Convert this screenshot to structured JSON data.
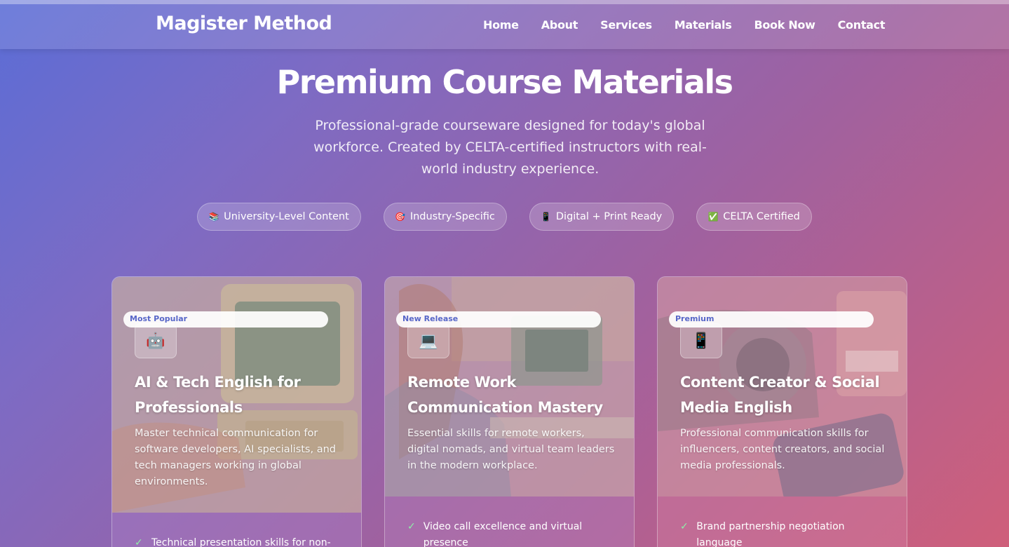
{
  "header": {
    "brand": "Magister Method",
    "nav": [
      "Home",
      "About",
      "Services",
      "Materials",
      "Book Now",
      "Contact"
    ]
  },
  "hero": {
    "title": "Premium Course Materials",
    "subtitle": "Professional-grade courseware designed for today's global workforce. Created by CELTA-certified instructors with real-world industry experience.",
    "badges": [
      {
        "icon": "books-icon",
        "glyph": "📚",
        "label": "University-Level Content"
      },
      {
        "icon": "target-icon",
        "glyph": "🎯",
        "label": "Industry-Specific"
      },
      {
        "icon": "mobile-icon",
        "glyph": "📱",
        "label": "Digital + Print Ready"
      },
      {
        "icon": "check-box-icon",
        "glyph": "✅",
        "label": "CELTA Certified"
      }
    ]
  },
  "courses": [
    {
      "tag": "Most Popular",
      "icon": "robot-icon",
      "glyph": "🤖",
      "title": "AI & Tech English for Professionals",
      "description": "Master technical communication for software developers, AI specialists, and tech managers working in global environments.",
      "feature": "Technical presentation skills for non-"
    },
    {
      "tag": "New Release",
      "icon": "laptop-icon",
      "glyph": "💻",
      "title": "Remote Work Communication Mastery",
      "description": "Essential skills for remote workers, digital nomads, and virtual team leaders in the modern workplace.",
      "feature": "Video call excellence and virtual presence"
    },
    {
      "tag": "Premium",
      "icon": "mobile-icon",
      "glyph": "📱",
      "title": "Content Creator & Social Media English",
      "description": "Professional communication skills for influencers, content creators, and social media professionals.",
      "feature": "Brand partnership negotiation language"
    }
  ],
  "colors": {
    "bg_start": "#5b6dd6",
    "bg_end": "#cf5f7a",
    "tag_text": "#5766c8",
    "check": "#8ef0a8"
  }
}
